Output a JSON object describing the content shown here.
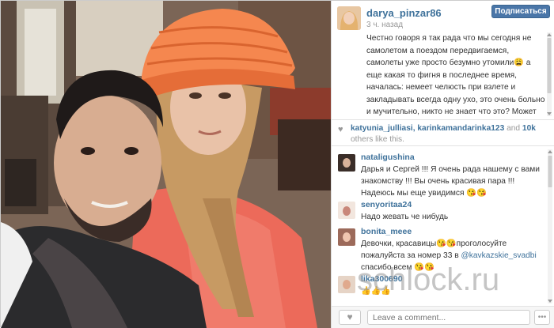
{
  "post": {
    "username": "darya_pinzar86",
    "time_ago": "3 ч. назад",
    "follow_label": "Подписаться",
    "caption": "Честно говоря я так рада что мы сегодня не самолетом а поездом передвигаемся, самолеты уже просто безумно утомили😩 а еще какая то фигня в последнее время, началась: немеет челюсть при взлете и закладывать всегда одну ухо, это очень больно и мучительно, никто не знает что это? Может спазм какой-то, вы уж извините что вам это пишу, ну мы уже как"
  },
  "likes": {
    "users": "katyunia_julliasi, karinkamandarinka123",
    "and": "and",
    "count": "10k",
    "others": "others like this."
  },
  "comments": [
    {
      "user": "nataligushina",
      "text": "Дарья и Сергей !!! Я очень рада нашему с вами знакомству !!! Вы очень красивая пара !!! Надеюсь мы еще увидимся 😘😘"
    },
    {
      "user": "senyoritaa24",
      "text": "Надо жевать че нибудь"
    },
    {
      "user": "bonita_meee",
      "text_before": "Девочки, красавицы😘😘проголосуйте пожалуйста за номер 33 в ",
      "mention": "@kavkazskie_svadbi",
      "text_after": " спасибо всем 😘😘"
    },
    {
      "user": "lika300690",
      "text": "👍👍👍"
    }
  ],
  "footer": {
    "heart": "♥",
    "comment_placeholder": "Leave a comment...",
    "more": "•••"
  },
  "watermark": "schlock.ru",
  "colors": {
    "link": "#3f729b",
    "follow_bg": "#4a76a8"
  }
}
